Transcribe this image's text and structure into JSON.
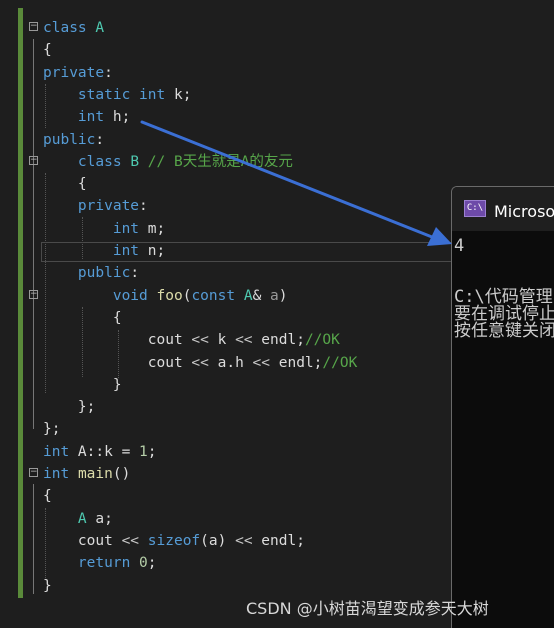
{
  "editor": {
    "lines": [
      {
        "fold": "−",
        "parts": [
          {
            "t": "class",
            "c": "kw"
          },
          {
            "t": " "
          },
          {
            "t": "A",
            "c": "ty"
          }
        ]
      },
      {
        "parts": [
          {
            "t": "{"
          }
        ]
      },
      {
        "parts": [
          {
            "t": "private",
            "c": "kw"
          },
          {
            "t": ":"
          }
        ]
      },
      {
        "parts": [
          {
            "t": "    "
          },
          {
            "t": "static",
            "c": "kw"
          },
          {
            "t": " "
          },
          {
            "t": "int",
            "c": "kw"
          },
          {
            "t": " k;"
          }
        ]
      },
      {
        "parts": [
          {
            "t": "    "
          },
          {
            "t": "int",
            "c": "kw"
          },
          {
            "t": " h;"
          }
        ]
      },
      {
        "parts": [
          {
            "t": "public",
            "c": "kw"
          },
          {
            "t": ":"
          }
        ]
      },
      {
        "fold": "−",
        "parts": [
          {
            "t": "    "
          },
          {
            "t": "class",
            "c": "kw"
          },
          {
            "t": " "
          },
          {
            "t": "B",
            "c": "ty"
          },
          {
            "t": " "
          },
          {
            "t": "// B天生就是A的友元",
            "c": "cm"
          }
        ]
      },
      {
        "parts": [
          {
            "t": "    {"
          }
        ]
      },
      {
        "parts": [
          {
            "t": "    "
          },
          {
            "t": "private",
            "c": "kw"
          },
          {
            "t": ":"
          }
        ]
      },
      {
        "parts": [
          {
            "t": "        "
          },
          {
            "t": "int",
            "c": "kw"
          },
          {
            "t": " m;"
          }
        ]
      },
      {
        "parts": [
          {
            "t": "        "
          },
          {
            "t": "int",
            "c": "kw"
          },
          {
            "t": " n;"
          }
        ]
      },
      {
        "parts": [
          {
            "t": "    "
          },
          {
            "t": "public",
            "c": "kw"
          },
          {
            "t": ":"
          }
        ]
      },
      {
        "fold": "−",
        "parts": [
          {
            "t": "        "
          },
          {
            "t": "void",
            "c": "kw"
          },
          {
            "t": " "
          },
          {
            "t": "foo",
            "c": "fn"
          },
          {
            "t": "("
          },
          {
            "t": "const",
            "c": "kw"
          },
          {
            "t": " "
          },
          {
            "t": "A",
            "c": "ty"
          },
          {
            "t": "& "
          },
          {
            "t": "a",
            "c": "pm"
          },
          {
            "t": ")"
          }
        ]
      },
      {
        "parts": [
          {
            "t": "        {"
          }
        ]
      },
      {
        "parts": [
          {
            "t": "            cout "
          },
          {
            "t": "<<",
            "c": "ck"
          },
          {
            "t": " k "
          },
          {
            "t": "<<",
            "c": "ck"
          },
          {
            "t": " endl;"
          },
          {
            "t": "//OK",
            "c": "cm"
          }
        ]
      },
      {
        "parts": [
          {
            "t": "            cout "
          },
          {
            "t": "<<",
            "c": "ck"
          },
          {
            "t": " a.h "
          },
          {
            "t": "<<",
            "c": "ck"
          },
          {
            "t": " endl;"
          },
          {
            "t": "//OK",
            "c": "cm"
          }
        ]
      },
      {
        "parts": [
          {
            "t": "        }"
          }
        ]
      },
      {
        "parts": [
          {
            "t": "    };"
          }
        ]
      },
      {
        "parts": [
          {
            "t": "};"
          }
        ]
      },
      {
        "parts": [
          {
            "t": "int",
            "c": "kw"
          },
          {
            "t": " A::k = "
          },
          {
            "t": "1",
            "c": "num"
          },
          {
            "t": ";"
          }
        ]
      },
      {
        "fold": "−",
        "parts": [
          {
            "t": "int",
            "c": "kw"
          },
          {
            "t": " "
          },
          {
            "t": "main",
            "c": "fn"
          },
          {
            "t": "()"
          }
        ]
      },
      {
        "parts": [
          {
            "t": "{"
          }
        ]
      },
      {
        "parts": [
          {
            "t": "    "
          },
          {
            "t": "A",
            "c": "ty"
          },
          {
            "t": " a;"
          }
        ]
      },
      {
        "parts": [
          {
            "t": "    cout "
          },
          {
            "t": "<<",
            "c": "ck"
          },
          {
            "t": " "
          },
          {
            "t": "sizeof",
            "c": "kw"
          },
          {
            "t": "(a) "
          },
          {
            "t": "<<",
            "c": "ck"
          },
          {
            "t": " endl;"
          }
        ]
      },
      {
        "parts": [
          {
            "t": "    "
          },
          {
            "t": "return",
            "c": "kw"
          },
          {
            "t": " "
          },
          {
            "t": "0",
            "c": "num"
          },
          {
            "t": ";"
          }
        ]
      },
      {
        "parts": [
          {
            "t": "}"
          }
        ]
      }
    ]
  },
  "console": {
    "icon_text": "C:\\",
    "title": "Microsoft Visual Studio 调试控制台",
    "output": [
      "4",
      "",
      "C:\\代码管理",
      "要在调试停止时自动关闭控制台",
      "按任意键关闭此窗口. . ."
    ]
  },
  "arrow_color": "#3b6fd4",
  "watermark": "CSDN @小树苗渴望变成参天大树"
}
